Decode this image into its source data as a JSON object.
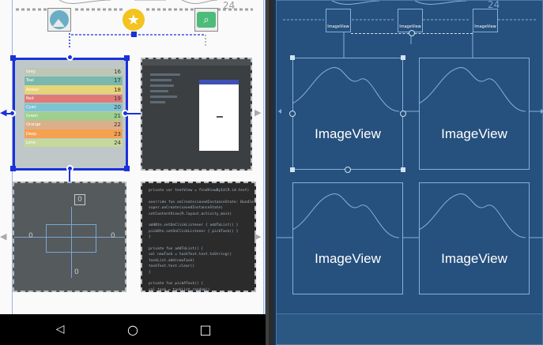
{
  "design": {
    "top_number": "24",
    "color_rows": [
      {
        "label": "Grey",
        "value": "16",
        "color": "#bcc8b5"
      },
      {
        "label": "Teal",
        "value": "17",
        "color": "#78b8ae"
      },
      {
        "label": "Amber",
        "value": "18",
        "color": "#e6d478"
      },
      {
        "label": "Red",
        "value": "19",
        "color": "#e07a75"
      },
      {
        "label": "Cyan",
        "value": "20",
        "color": "#7cc4cf"
      },
      {
        "label": "Green",
        "value": "21",
        "color": "#9fcf8f"
      },
      {
        "label": "Orange",
        "value": "22",
        "color": "#ddae8a"
      },
      {
        "label": "Deep",
        "value": "23",
        "color": "#f5a150"
      },
      {
        "label": "Lime",
        "value": "24",
        "color": "#c7d99a"
      }
    ],
    "constraint_preview": {
      "top_value": "0",
      "left_value": "0",
      "right_value": "0",
      "bottom_value": "0"
    },
    "code_lines": [
      "private var textView = findViewById(R.id.text)",
      "",
      "override fun onCreate(savedInstanceState: Bundle?) {",
      "    super.onCreate(savedInstanceState)",
      "    setContentView(R.layout.activity_main)",
      "",
      "    addBtn.setOnClickListener { addToList() }",
      "    pickBtn.setOnClickListener { pickTask() }",
      "}",
      "",
      "private fun addToList() {",
      "    val newTask = taskText.text.toString()",
      "    taskList.add(newTask)",
      "    taskText.text.clear()",
      "}",
      "",
      "private fun pickATask() {",
      "    val task = taskList.random()"
    ],
    "nav": {
      "back": "◁",
      "home": "○",
      "recents": "□"
    }
  },
  "blueprint": {
    "top_number": "24",
    "small_labels": [
      "ImageView",
      "ImageView",
      "ImageView"
    ],
    "tiles": [
      {
        "label": "ImageView"
      },
      {
        "label": "ImageView"
      },
      {
        "label": "ImageView"
      },
      {
        "label": "ImageView"
      }
    ]
  }
}
